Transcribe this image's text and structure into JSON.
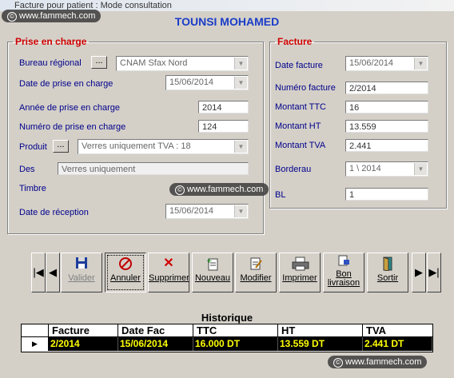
{
  "window": {
    "title": "Facture pour patient : Mode consultation"
  },
  "watermark": {
    "text": "www.fammech.com"
  },
  "app_title": "TOUNSI MOHAMED",
  "prise_en_charge": {
    "legend": "Prise en charge",
    "bureau_label": "Bureau régional",
    "bureau_value": "CNAM Sfax Nord",
    "date_pec_label": "Date de prise en charge",
    "date_pec_value": "15/06/2014",
    "annee_label": "Année de prise en charge",
    "annee_value": "2014",
    "numero_label": "Numéro de prise en charge",
    "numero_value": "124",
    "produit_label": "Produit",
    "produit_value": "Verres uniquement  TVA : 18",
    "des_label": "Des",
    "des_value": "Verres uniquement",
    "timbre_label": "Timbre",
    "date_reception_label": "Date de réception",
    "date_reception_value": "15/06/2014",
    "dots": "..."
  },
  "facture": {
    "legend": "Facture",
    "date_label": "Date facture",
    "date_value": "15/06/2014",
    "numero_label": "Numéro facture",
    "numero_value": "2/2014",
    "ttc_label": "Montant TTC",
    "ttc_value": "16",
    "ht_label": "Montant HT",
    "ht_value": "13.559",
    "tva_label": "Montant TVA",
    "tva_value": "2.441",
    "borderau_label": "Borderau",
    "borderau_value": "1 \\ 2014",
    "bl_label": "BL",
    "bl_value": "1"
  },
  "toolbar": {
    "first": "⏮",
    "prev": "◀",
    "next": "▶",
    "last": "⏭",
    "valider": "Valider",
    "annuler": "Annuler",
    "supprimer": "Supprimer",
    "nouveau": "Nouveau",
    "modifier": "Modifier",
    "imprimer": "Imprimer",
    "bon": "Bon livraison",
    "sortir": "Sortir"
  },
  "historique": {
    "title": "Historique",
    "columns": [
      "Facture",
      "Date Fac",
      "TTC",
      "HT",
      "TVA"
    ],
    "rows": [
      [
        "2/2014",
        "15/06/2014",
        "16.000 DT",
        "13.559 DT",
        "2.441 DT"
      ]
    ]
  },
  "colors": {
    "accent": "#1a3cc8",
    "legend": "#d00000",
    "label": "#00008b",
    "row_text": "#ffff00"
  }
}
